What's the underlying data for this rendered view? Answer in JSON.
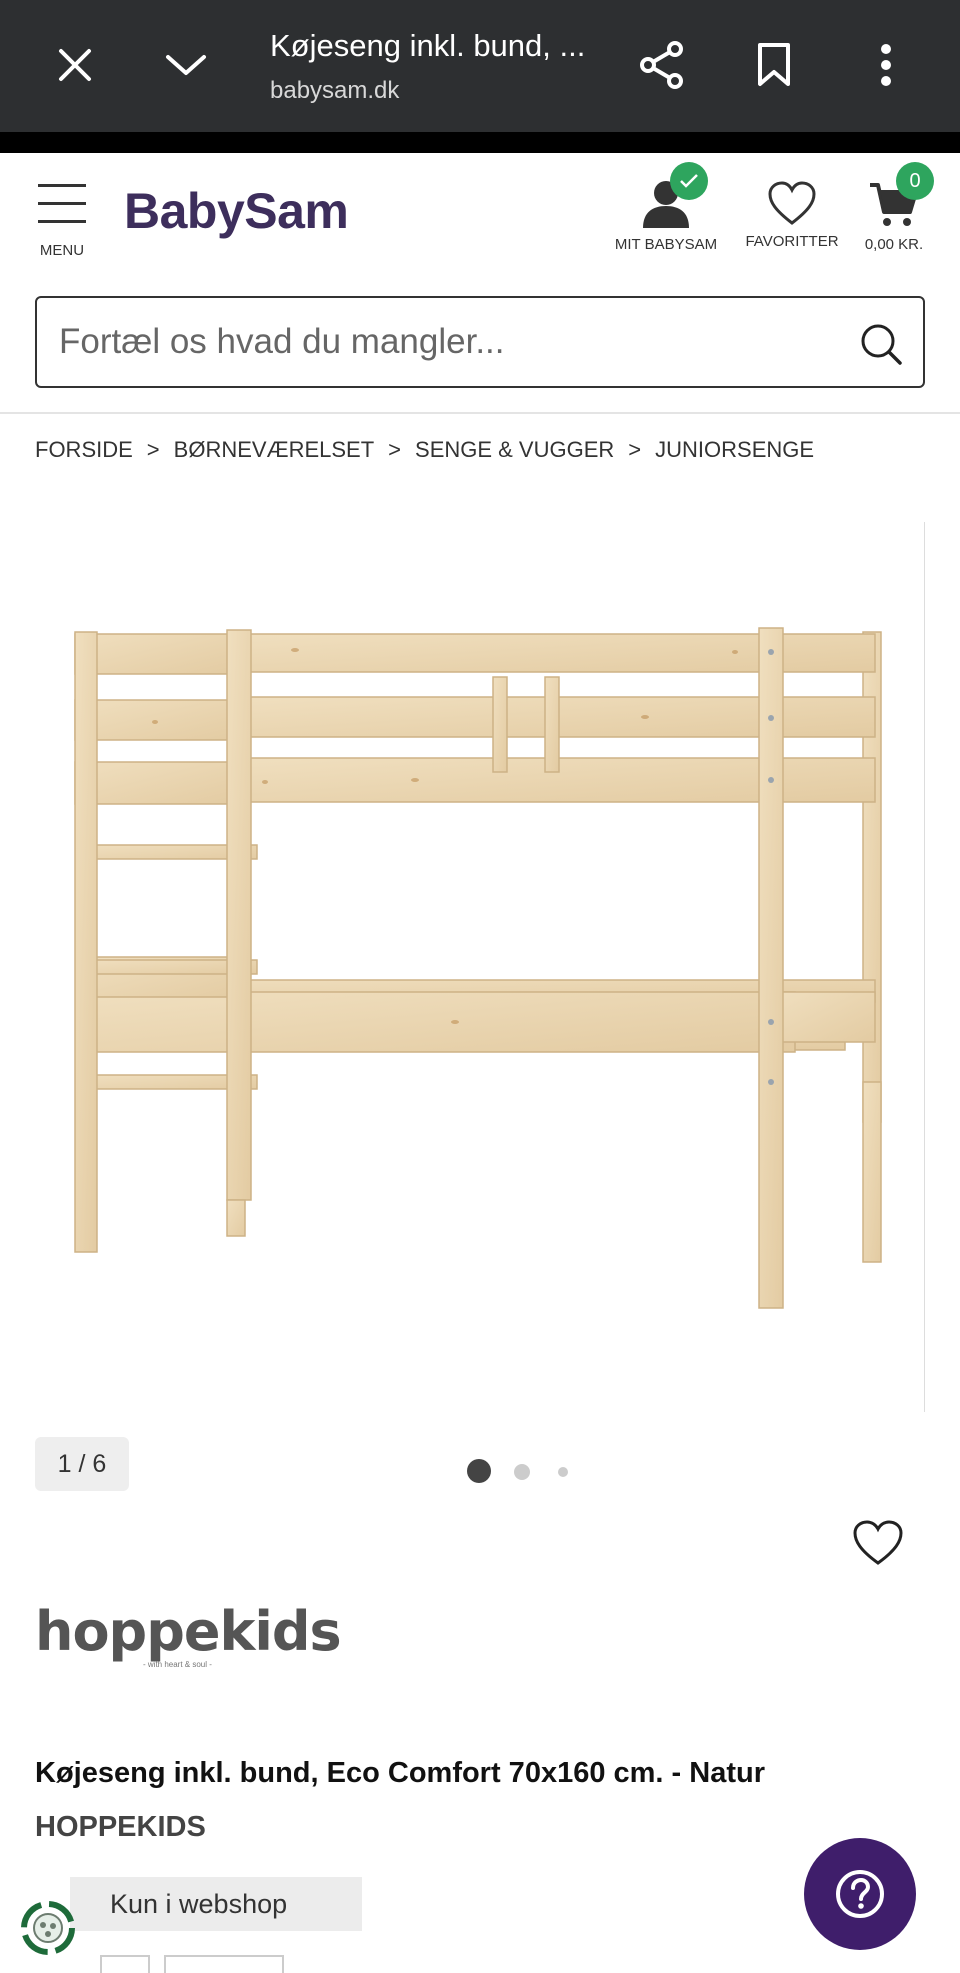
{
  "browser": {
    "title": "Køjeseng inkl. bund, ...",
    "url": "babysam.dk"
  },
  "header": {
    "menu_label": "MENU",
    "logo": "BabySam",
    "account_label": "MIT BABYSAM",
    "favorites_label": "FAVORITTER",
    "cart_label": "0,00 KR.",
    "cart_count": "0"
  },
  "search": {
    "placeholder": "Fortæl os hvad du mangler..."
  },
  "breadcrumb": {
    "items": [
      "FORSIDE",
      "BØRNEVÆRELSET",
      "SENGE & VUGGER",
      "JUNIORSENGE"
    ],
    "separator": ">"
  },
  "gallery": {
    "counter": "1 / 6",
    "current": 1,
    "total": 6
  },
  "brand_logo": {
    "word": "hoppekids",
    "tagline": "- with heart & soul -"
  },
  "product": {
    "title": "Køjeseng inkl. bund, Eco Comfort 70x160 cm. - Natur",
    "brand": "HOPPEKIDS",
    "availability": "Kun i webshop"
  },
  "colors": {
    "toolbar": "#2d2f31",
    "logo": "#3d2e5c",
    "badge_green": "#2ea55e",
    "help_purple": "#3f1e6b",
    "wood": "#ecd9b6"
  },
  "icons": {
    "close": "close-icon",
    "collapse": "chevron-down-icon",
    "share": "share-icon",
    "bookmark": "bookmark-icon",
    "more": "more-vert-icon",
    "menu": "hamburger-icon",
    "account": "user-icon",
    "favorites": "heart-icon",
    "cart": "cart-icon",
    "search": "search-icon",
    "help": "help-icon"
  }
}
